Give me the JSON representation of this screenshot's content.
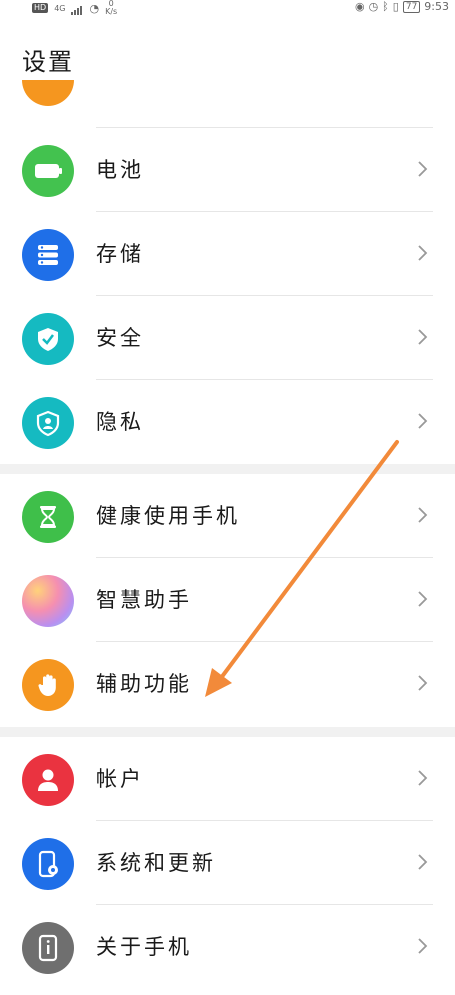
{
  "status_bar": {
    "network": "HD",
    "signal": "4G",
    "speed_value": "0",
    "speed_unit": "K/s",
    "battery": "77",
    "time": "9:53"
  },
  "page": {
    "title": "设置"
  },
  "rows": [
    {
      "label": "电池",
      "icon": "battery-icon",
      "color": "#43c24f"
    },
    {
      "label": "存储",
      "icon": "storage-icon",
      "color": "#1f6fe8"
    },
    {
      "label": "安全",
      "icon": "shield-check-icon",
      "color": "#15bac1"
    },
    {
      "label": "隐私",
      "icon": "privacy-shield-icon",
      "color": "#15bac1"
    },
    {
      "label": "健康使用手机",
      "icon": "hourglass-icon",
      "color": "#3fbf4a"
    },
    {
      "label": "智慧助手",
      "icon": "smart-assistant-icon",
      "color": "#c78ce8"
    },
    {
      "label": "辅助功能",
      "icon": "hand-icon",
      "color": "#f5961f"
    },
    {
      "label": "帐户",
      "icon": "user-icon",
      "color": "#ea3340"
    },
    {
      "label": "系统和更新",
      "icon": "phone-settings-icon",
      "color": "#1f6fe8"
    },
    {
      "label": "关于手机",
      "icon": "phone-info-icon",
      "color": "#6f6f6f"
    }
  ],
  "annotation": {
    "arrow_color": "#f28a3a"
  }
}
